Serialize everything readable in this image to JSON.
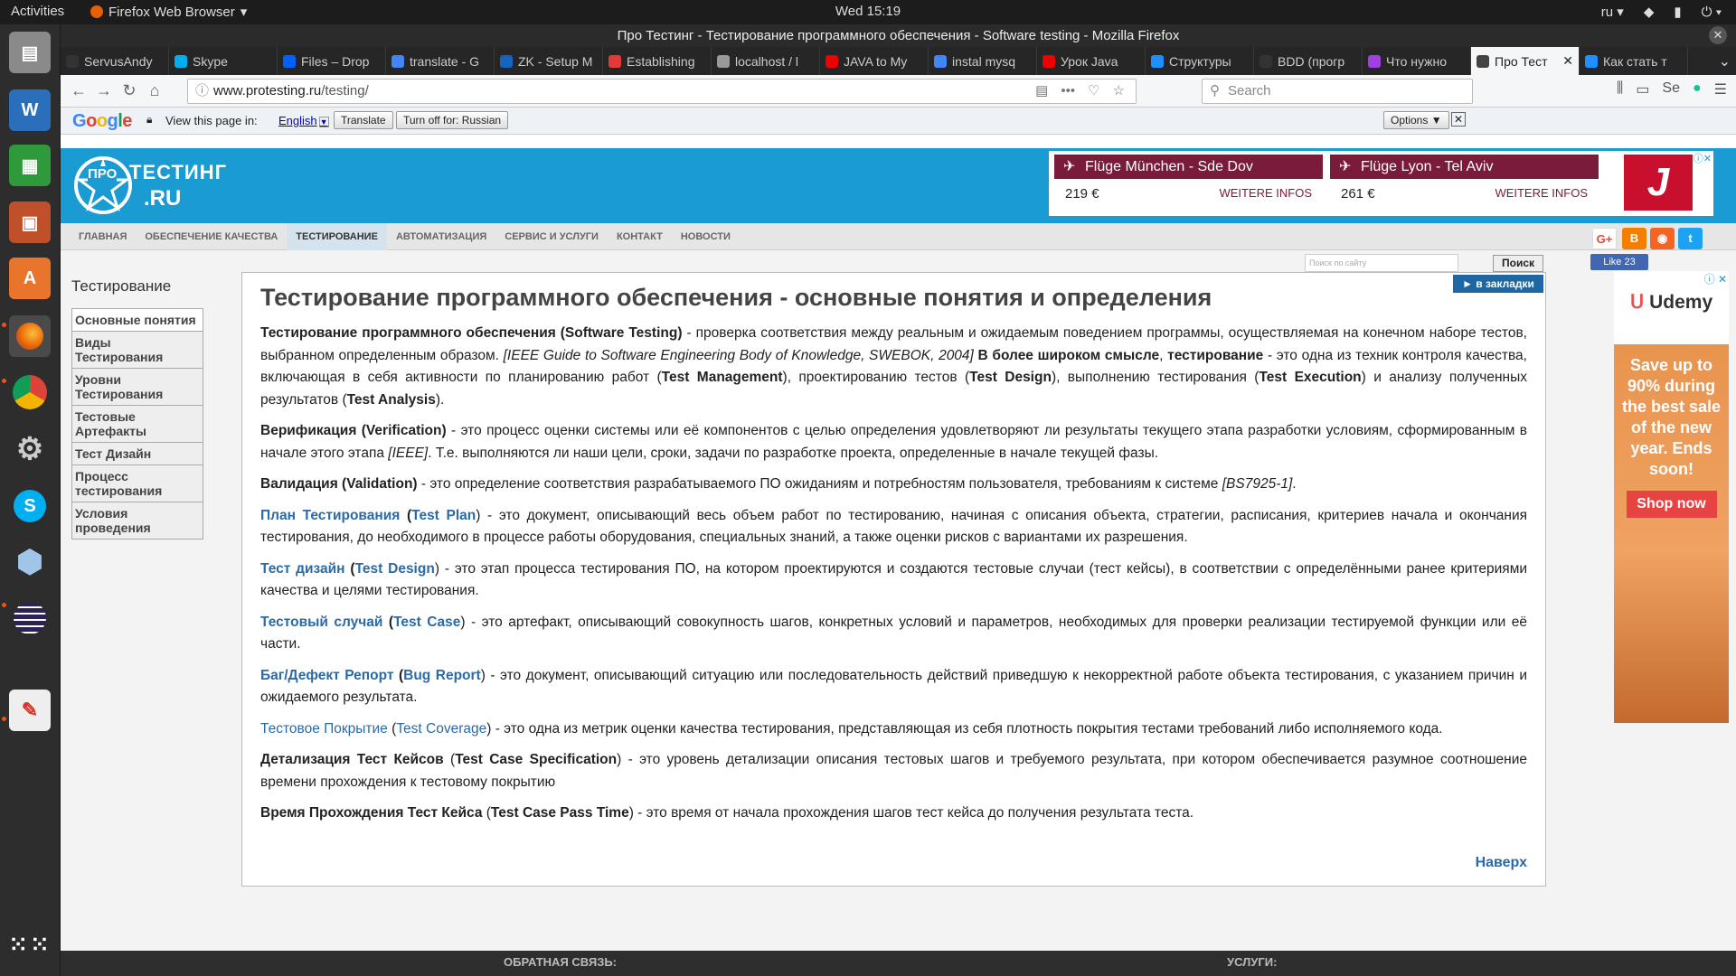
{
  "system": {
    "activities": "Activities",
    "app_name": "Firefox Web Browser",
    "clock": "Wed 15:19",
    "lang": "ru"
  },
  "window": {
    "title": "Про Тестинг - Тестирование программного обеспечения - Software testing - Mozilla Firefox"
  },
  "tabs": [
    {
      "label": "ServusAndy",
      "color": "#333"
    },
    {
      "label": "Skype",
      "color": "#00aff0"
    },
    {
      "label": "Files – Drop",
      "color": "#0061fe"
    },
    {
      "label": "translate - G",
      "color": "#4285f4"
    },
    {
      "label": "ZK - Setup M",
      "color": "#1565c0"
    },
    {
      "label": "Establishing",
      "color": "#e53935"
    },
    {
      "label": "localhost / l",
      "color": "#999"
    },
    {
      "label": "JAVA to My",
      "color": "#e00"
    },
    {
      "label": "instal mysq",
      "color": "#4285f4"
    },
    {
      "label": "Урок Java",
      "color": "#e00"
    },
    {
      "label": "Структуры",
      "color": "#1e90ff"
    },
    {
      "label": "BDD (прогр",
      "color": "#333"
    },
    {
      "label": "Что нужно",
      "color": "#a040e0"
    },
    {
      "label": "Про Тест",
      "color": "#444"
    },
    {
      "label": "Как стать т",
      "color": "#1e90ff"
    }
  ],
  "browser": {
    "url_domain": "www.protesting.ru",
    "url_path": "/testing/",
    "search_placeholder": "Search"
  },
  "translate_bar": {
    "logo": "Google",
    "view_label": "View this page in:",
    "language": "English",
    "translate_btn": "Translate",
    "turn_off_btn": "Turn off for: Russian",
    "options_btn": "Options ▼"
  },
  "site": {
    "logo_line1": "ПРО",
    "logo_line2": "ТЕСТИНГ",
    "logo_line3": ".RU",
    "flights": [
      {
        "title": "Flüge München - Sde Dov",
        "price": "219 €",
        "cta": "WEITERE INFOS"
      },
      {
        "title": "Flüge Lyon - Tel Aviv",
        "price": "261 €",
        "cta": "WEITERE INFOS"
      }
    ],
    "menu": [
      "ГЛАВНАЯ",
      "ОБЕСПЕЧЕНИЕ КАЧЕСТВА",
      "ТЕСТИРОВАНИЕ",
      "АВТОМАТИЗАЦИЯ",
      "СЕРВИС И УСЛУГИ",
      "КОНТАКТ",
      "НОВОСТИ"
    ],
    "search_btn": "Поиск",
    "search_placeholder": "Поиск по сайту",
    "like": "Like 23",
    "bookmarks": "► в закладки",
    "sidebar_title": "Тестирование",
    "sidebar": [
      "Основные понятия",
      "Виды Тестирования",
      "Уровни Тестирования",
      "Тестовые Артефакты",
      "Тест Дизайн",
      "Процесс тестирования",
      "Условия проведения"
    ],
    "heading": "Тестирование программного обеспечения - основные понятия и определения",
    "to_top": "Наверх",
    "footer_left": "ОБРАТНАЯ СВЯЗЬ:",
    "footer_right": "УСЛУГИ:",
    "ad_brand": "Udemy",
    "ad_text": "Save up to 90% during the best sale of the new year. Ends soon!",
    "ad_btn": "Shop now"
  },
  "article": {
    "p1": {
      "b1": "Тестирование программного обеспечения (Software Testing)",
      "t1": " - проверка соответствия между реальным и ожидаемым поведением программы, осуществляемая на конечном наборе тестов, выбранном определенным образом. ",
      "i1": "[IEEE Guide to Software Engineering Body of Knowledge, SWEBOK, 2004]",
      "b2": " В более широком смысле",
      "t2": ", ",
      "b3": "тестирование",
      "t3": " - это одна из техник контроля качества, включающая в себя активности по планированию работ (",
      "b4": "Test Management",
      "t4": "), проектированию тестов (",
      "b5": "Test Design",
      "t5": "), выполнению тестирования (",
      "b6": "Test Execution",
      "t6": ") и анализу полученных результатов (",
      "b7": "Test Analysis",
      "t7": ")."
    },
    "p2": {
      "b1": "Верификация (Verification)",
      "t1": " - это процесс оценки системы или её компонентов с целью определения удовлетворяют ли результаты текущего этапа разработки условиям, сформированным в начале этого этапа ",
      "i1": "[IEEE]",
      "t2": ". Т.е. выполняются ли наши цели, сроки, задачи по разработке проекта, определенные в начале текущей фазы."
    },
    "p3": {
      "b1": "Валидация (Validation)",
      "t1": " - это определение соответствия разрабатываемого ПО ожиданиям и потребностям пользователя, требованиям к системе ",
      "i1": "[BS7925-1]",
      "t2": "."
    },
    "p4": {
      "l1": "План Тестирования",
      "o": " (",
      "l2": "Test Plan",
      "t1": ") - это документ, описывающий весь объем работ по тестированию, начиная с описания объекта, стратегии, расписания, критериев начала и окончания тестирования, до необходимого в процессе работы оборудования, специальных знаний, а также оценки рисков с вариантами их разрешения."
    },
    "p5": {
      "l1": "Тест дизайн",
      "o": " (",
      "l2": "Test Design",
      "t1": ") - это этап процесса тестирования ПО, на котором проектируются и создаются тестовые случаи (тест кейсы), в соответствии с определёнными ранее критериями качества и целями тестирования."
    },
    "p6": {
      "l1": "Тестовый случай",
      "o": " (",
      "l2": "Test Case",
      "t1": ") - это артефакт, описывающий совокупность шагов, конкретных условий и параметров, необходимых для проверки реализации тестируемой функции или её части."
    },
    "p7": {
      "l1": "Баг/Дефект Репорт",
      "o": " (",
      "l2": "Bug Report",
      "t1": ") - это документ, описывающий ситуацию или последовательность действий приведшую к некорректной работе объекта тестирования, с указанием причин и ожидаемого результата."
    },
    "p8": {
      "l1": "Тестовое Покрытие",
      "o": " (",
      "l2": "Test Coverage",
      "t1": ") - это одна из метрик оценки качества тестирования, представляющая из себя плотность покрытия тестами требований либо исполняемого кода."
    },
    "p9": {
      "b1": "Детализация Тест Кейсов",
      "o": " (",
      "b2": "Test Case Specification",
      "t1": ") - это уровень детализации описания тестовых шагов и требуемого результата, при котором обеспечивается разумное соотношение времени прохождения к тестовому покрытию"
    },
    "p10": {
      "b1": "Время Прохождения Тест Кейса",
      "o": " (",
      "b2": "Test Case Pass Time",
      "t1": ") - это время от начала прохождения шагов тест кейса до получения результата теста."
    }
  }
}
